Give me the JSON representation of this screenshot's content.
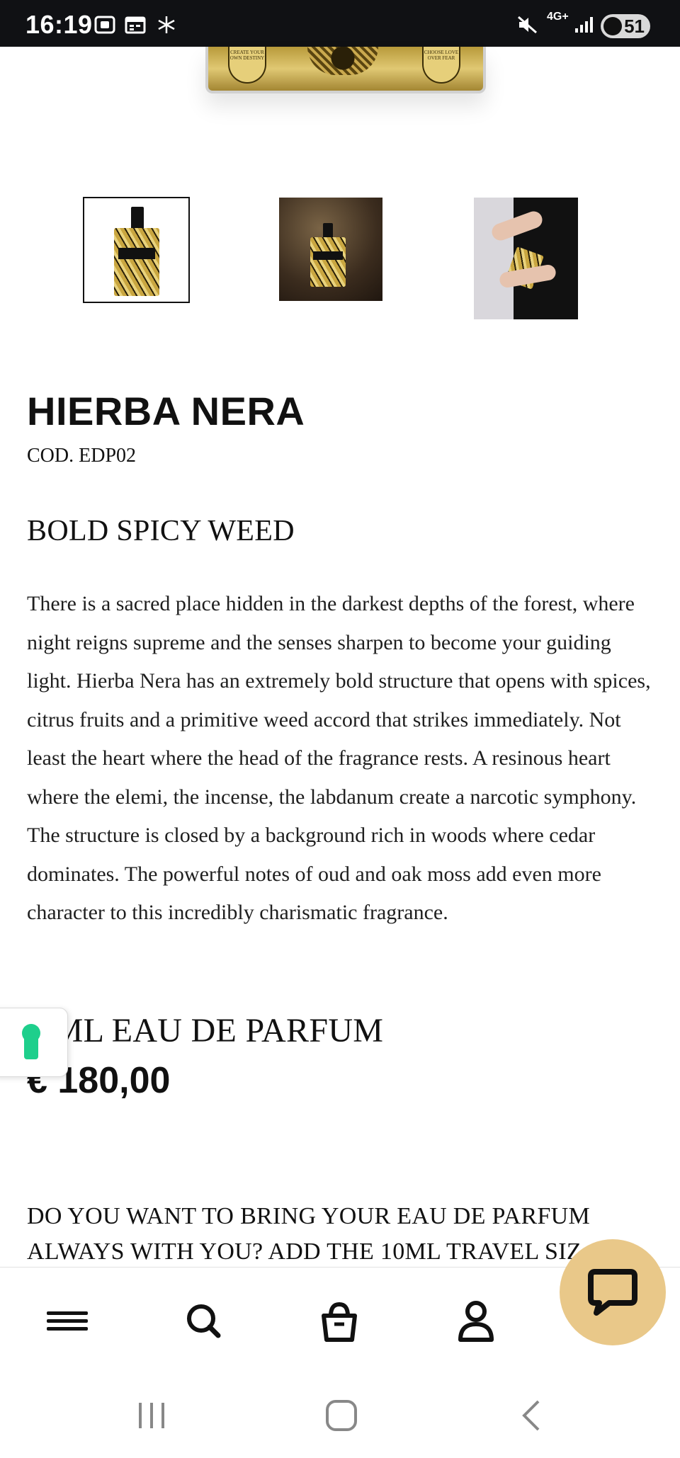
{
  "status_bar": {
    "time": "16:19",
    "network": "4G+",
    "battery": "51",
    "icons": [
      "screenshot-icon",
      "calendar-icon",
      "snowflake-icon",
      "mute-icon",
      "signal-icon",
      "battery-icon"
    ]
  },
  "product": {
    "name": "HIERBA NERA",
    "code": "COD. EDP02",
    "subtitle": "BOLD SPICY WEED",
    "description": "There is a sacred place hidden in the darkest depths of the forest, where night reigns supreme and the senses sharpen to become your guiding light. Hierba Nera has an extremely bold structure that opens with spices, citrus fruits and a primitive weed accord that strikes immediately. Not least the heart where the head of the fragrance rests. A resinous heart where the elemi, the incense, the labdanum create a narcotic symphony. The structure is closed by a background rich in woods where cedar dominates. The powerful notes of oud and oak moss add even more character to this incredibly charismatic fragrance.",
    "size": "0 ML EAU DE PARFUM",
    "price": "€ 180,00",
    "travel_prompt": "DO YOU WANT TO BRING YOUR EAU DE PARFUM ALWAYS WITH YOU? ADD THE 10ML TRAVEL SIZ",
    "thumbnails": [
      {
        "name": "bottle-front",
        "selected": true
      },
      {
        "name": "bottle-scene",
        "selected": false
      },
      {
        "name": "bottle-in-hands",
        "selected": false
      }
    ],
    "hero_panels": {
      "left": "CREATE YOUR OWN DESTINY",
      "right": "CHOOSE LOVE OVER FEAR"
    }
  },
  "colors": {
    "status_bar_bg": "#101114",
    "chat_button": "#e9c889",
    "privacy_badge": "#1ecf8c",
    "text": "#111111"
  },
  "bottom_nav": {
    "items": [
      "menu-icon",
      "search-icon",
      "basket-icon",
      "account-icon"
    ]
  },
  "system_nav": [
    "recent-apps",
    "home",
    "back"
  ]
}
